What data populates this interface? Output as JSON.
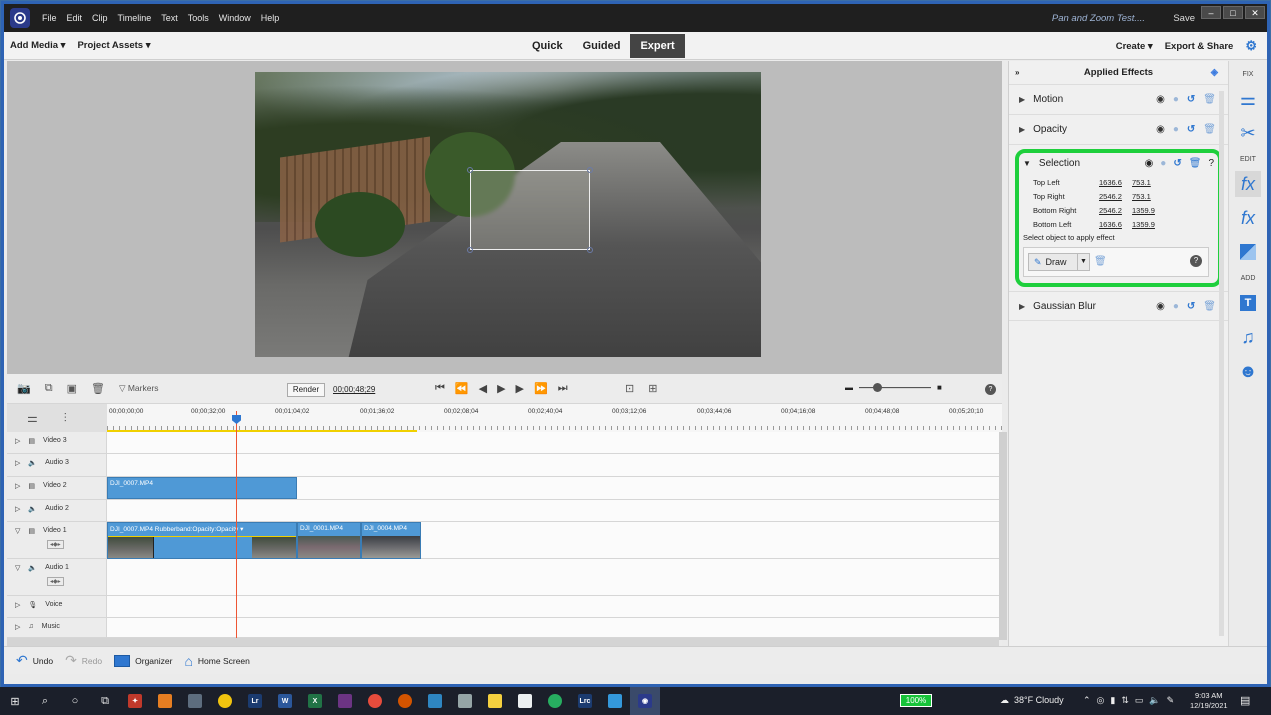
{
  "titlebar": {
    "menu": [
      "File",
      "Edit",
      "Clip",
      "Timeline",
      "Text",
      "Tools",
      "Window",
      "Help"
    ],
    "doc_title": "Pan and Zoom Test....",
    "save": "Save",
    "win_buttons": [
      "‒",
      "□",
      "✕"
    ]
  },
  "modebar": {
    "add_media": "Add Media ▾",
    "project_assets": "Project Assets ▾",
    "modes": [
      "Quick",
      "Guided",
      "Expert"
    ],
    "active_mode": "Expert",
    "create": "Create ▾",
    "export_share": "Export & Share"
  },
  "effects_panel": {
    "title": "Applied Effects",
    "effects": [
      {
        "name": "Motion"
      },
      {
        "name": "Opacity"
      },
      {
        "name": "Selection"
      },
      {
        "name": "Gaussian Blur"
      }
    ],
    "selection": {
      "coords": [
        {
          "label": "Top Left",
          "x": "1636.6",
          "y": "753.1"
        },
        {
          "label": "Top Right",
          "x": "2546.2",
          "y": "753.1"
        },
        {
          "label": "Bottom Right",
          "x": "2546.2",
          "y": "1359.9"
        },
        {
          "label": "Bottom Left",
          "x": "1636.6",
          "y": "1359.9"
        }
      ],
      "hint": "Select object to apply effect",
      "draw": "Draw"
    }
  },
  "sidebar": {
    "fix": "FIX",
    "edit": "EDIT",
    "add": "ADD"
  },
  "timeline": {
    "markers": "Markers",
    "render": "Render",
    "timecode": "00;00;48;29",
    "ruler_ticks": [
      "00;00;00;00",
      "00;00;32;00",
      "00;01;04;02",
      "00;01;36;02",
      "00;02;08;04",
      "00;02;40;04",
      "00;03;12;06",
      "00;03;44;06",
      "00;04;16;08",
      "00;04;48;08",
      "00;05;20;10"
    ],
    "tracks": [
      "Video 3",
      "Audio 3",
      "Video 2",
      "Audio 2",
      "Video 1",
      "Audio 1",
      "Voice",
      "Music"
    ],
    "clips": {
      "video2": "DJI_0007.MP4",
      "video1_a": "DJI_0007.MP4 Rubberband:Opacity:Opacity ▾",
      "video1_b": "DJI_0001.MP4",
      "video1_c": "DJI_0004.MP4"
    }
  },
  "bottombar": {
    "undo": "Undo",
    "redo": "Redo",
    "organizer": "Organizer",
    "home": "Home Screen"
  },
  "taskbar": {
    "battery": "100%",
    "weather": "38°F  Cloudy",
    "time": "9:03 AM",
    "date": "12/19/2021"
  }
}
